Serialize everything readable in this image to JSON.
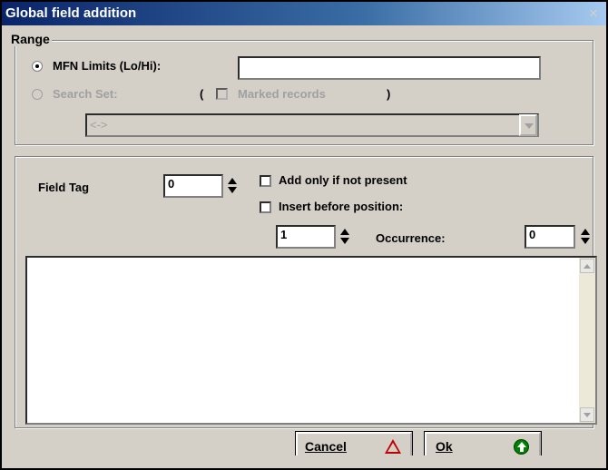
{
  "window": {
    "title": "Global field addition",
    "close_glyph": "×"
  },
  "range": {
    "label": "Range",
    "mfn_limits_label": "MFN Limits (Lo/Hi):",
    "mfn_limits_value": "",
    "search_set_label": "Search Set:",
    "open_paren": "(",
    "marked_records_label": "Marked records",
    "close_paren": ")",
    "search_set_value": "<->"
  },
  "field": {
    "field_tag_label": "Field Tag",
    "field_tag_value": "0",
    "add_only_label": "Add only if not present",
    "insert_before_label": "Insert before position:",
    "position_value": "1",
    "occurrence_label": "Occurrence:",
    "occurrence_value": "0",
    "memo_text": ""
  },
  "buttons": {
    "cancel_label": "Cancel",
    "ok_label": "Ok"
  },
  "icons": {
    "cancel": "warning-icon",
    "ok": "up-arrow-circle-icon"
  },
  "colors": {
    "title_start": "#0a246a",
    "title_end": "#a6caf0",
    "ok_icon": "#008000",
    "cancel_icon": "#c00000"
  }
}
